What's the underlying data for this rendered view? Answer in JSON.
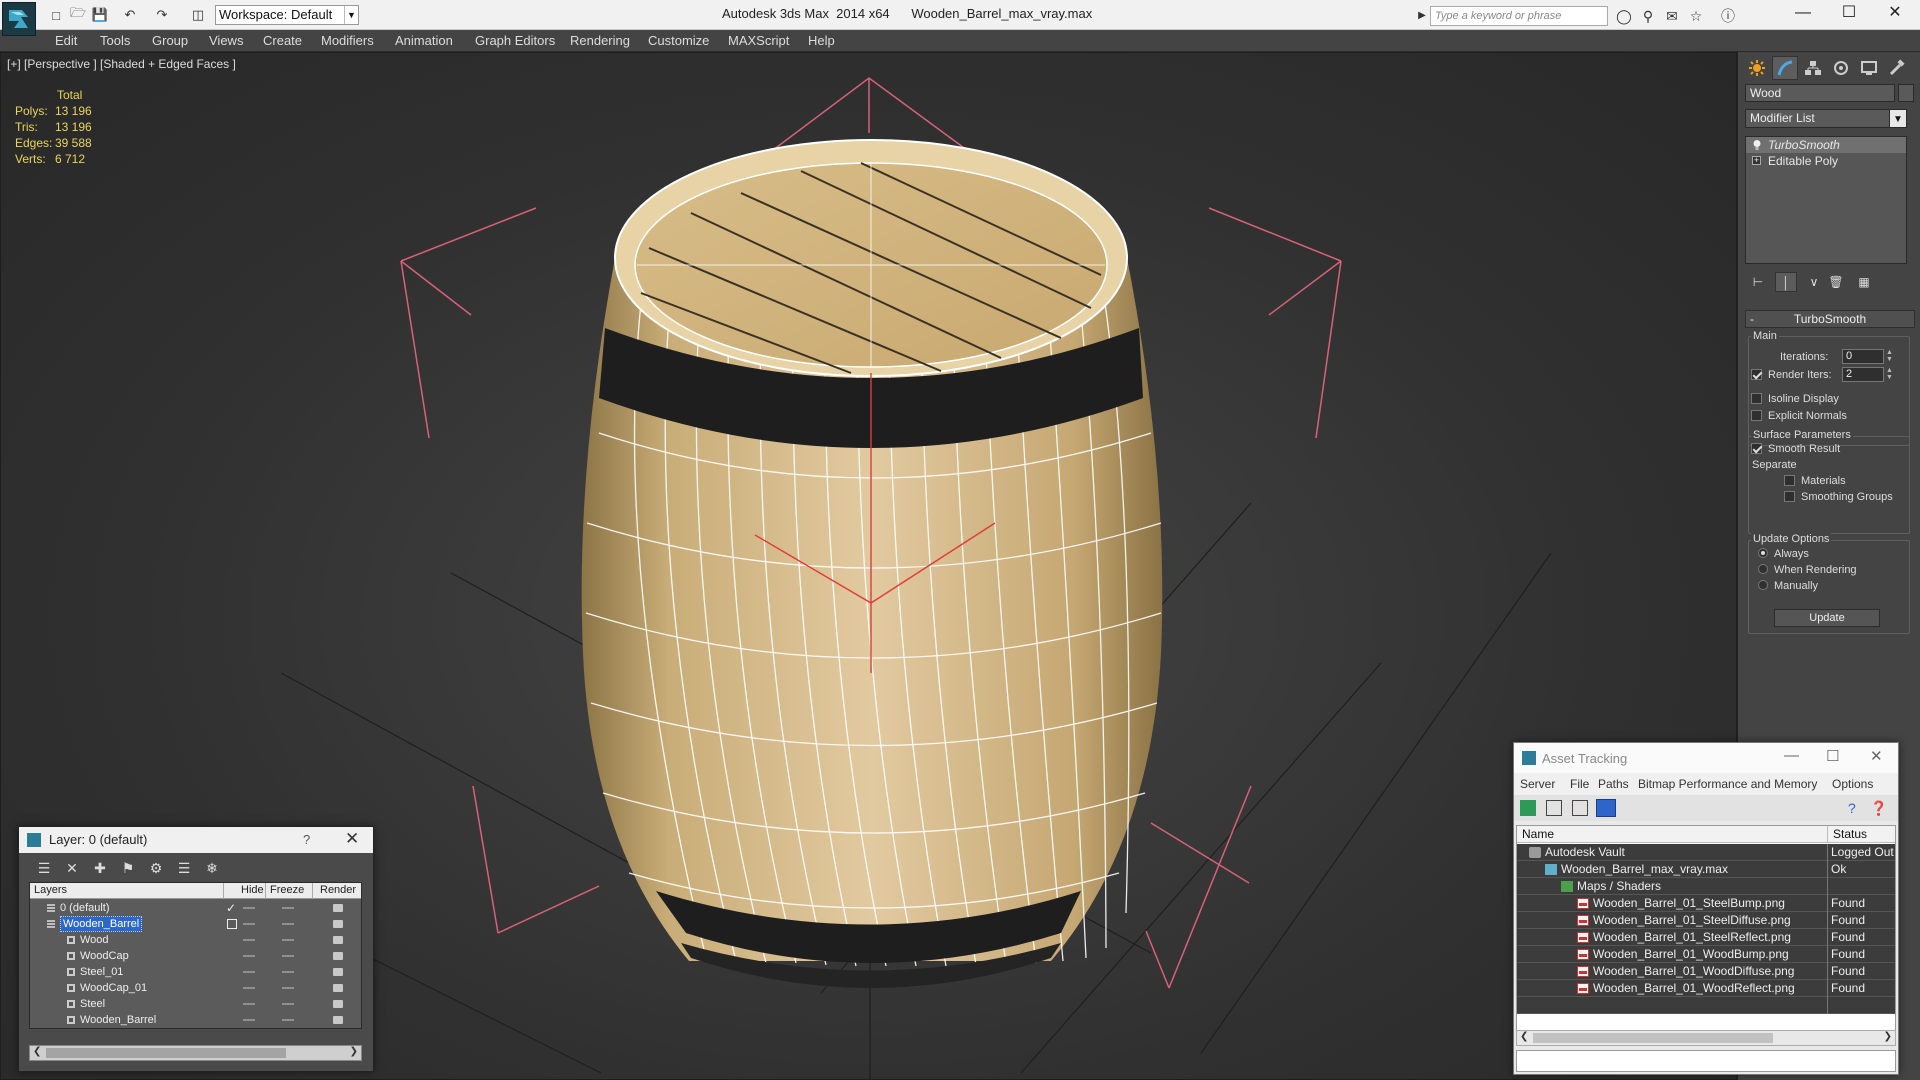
{
  "titlebar": {
    "workspace_label": "Workspace: Default",
    "title": "Autodesk 3ds Max  2014 x64      Wooden_Barrel_max_vray.max",
    "search_placeholder": "Type a keyword or phrase"
  },
  "menu": [
    "Edit",
    "Tools",
    "Group",
    "Views",
    "Create",
    "Modifiers",
    "Animation",
    "Graph Editors",
    "Rendering",
    "Customize",
    "MAXScript",
    "Help"
  ],
  "viewport": {
    "label": "[+] [Perspective ] [Shaded + Edged Faces ]",
    "stats": {
      "total_label": "Total",
      "rows": [
        {
          "label": "Polys:",
          "value": "13 196"
        },
        {
          "label": "Tris:",
          "value": "13 196"
        },
        {
          "label": "Edges:",
          "value": "39 588"
        },
        {
          "label": "Verts:",
          "value": "6 712"
        }
      ]
    }
  },
  "command_panel": {
    "object_name": "Wood",
    "modifier_list_label": "Modifier List",
    "stack": [
      {
        "label": "TurboSmooth",
        "selected": true
      },
      {
        "label": "Editable Poly",
        "selected": false
      }
    ],
    "rollout_title": "TurboSmooth",
    "main_label": "Main",
    "iterations_label": "Iterations:",
    "iterations_value": "0",
    "render_iters_label": "Render Iters:",
    "render_iters_value": "2",
    "isoline_label": "Isoline Display",
    "explicit_normals_label": "Explicit Normals",
    "surface_params_label": "Surface Parameters",
    "smooth_result_label": "Smooth Result",
    "separate_label": "Separate",
    "materials_label": "Materials",
    "smoothing_groups_label": "Smoothing Groups",
    "update_options_label": "Update Options",
    "always_label": "Always",
    "when_rendering_label": "When Rendering",
    "manually_label": "Manually",
    "update_button": "Update"
  },
  "layer_panel": {
    "title": "Layer: 0 (default)",
    "help": "?",
    "columns": {
      "layers": "Layers",
      "hide": "Hide",
      "freeze": "Freeze",
      "render": "Render"
    },
    "rows": [
      {
        "name": "0 (default)",
        "indent": 0,
        "selected": false,
        "check": true
      },
      {
        "name": "Wooden_Barrel",
        "indent": 0,
        "selected": true,
        "check": false
      },
      {
        "name": "Wood",
        "indent": 1,
        "selected": false,
        "check": false
      },
      {
        "name": "WoodCap",
        "indent": 1,
        "selected": false,
        "check": false
      },
      {
        "name": "Steel_01",
        "indent": 1,
        "selected": false,
        "check": false
      },
      {
        "name": "WoodCap_01",
        "indent": 1,
        "selected": false,
        "check": false
      },
      {
        "name": "Steel",
        "indent": 1,
        "selected": false,
        "check": false
      },
      {
        "name": "Wooden_Barrel",
        "indent": 1,
        "selected": false,
        "check": false
      }
    ]
  },
  "asset_panel": {
    "title": "Asset Tracking",
    "menu": [
      "Server",
      "File",
      "Paths",
      "Bitmap Performance and Memory",
      "Options"
    ],
    "columns": {
      "name": "Name",
      "status": "Status"
    },
    "rows": [
      {
        "name": "Autodesk Vault",
        "status": "Logged Out",
        "indent": 0,
        "icon": "vault"
      },
      {
        "name": "Wooden_Barrel_max_vray.max",
        "status": "Ok",
        "indent": 1,
        "icon": "max"
      },
      {
        "name": "Maps / Shaders",
        "status": "",
        "indent": 2,
        "icon": "maps"
      },
      {
        "name": "Wooden_Barrel_01_SteelBump.png",
        "status": "Found",
        "indent": 3,
        "icon": "png"
      },
      {
        "name": "Wooden_Barrel_01_SteelDiffuse.png",
        "status": "Found",
        "indent": 3,
        "icon": "png"
      },
      {
        "name": "Wooden_Barrel_01_SteelReflect.png",
        "status": "Found",
        "indent": 3,
        "icon": "png"
      },
      {
        "name": "Wooden_Barrel_01_WoodBump.png",
        "status": "Found",
        "indent": 3,
        "icon": "png"
      },
      {
        "name": "Wooden_Barrel_01_WoodDiffuse.png",
        "status": "Found",
        "indent": 3,
        "icon": "png"
      },
      {
        "name": "Wooden_Barrel_01_WoodReflect.png",
        "status": "Found",
        "indent": 3,
        "icon": "png"
      }
    ]
  },
  "colors": {
    "stats_text": "#e8d55a",
    "selection_blue": "#2d68c8",
    "gizmo_pink": "#d8607a",
    "wood": "#d9c08a",
    "steel_band": "#1e1e1e"
  }
}
